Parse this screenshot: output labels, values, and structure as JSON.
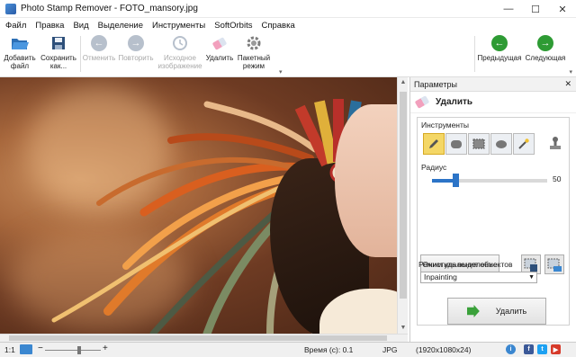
{
  "window": {
    "title": "Photo Stamp Remover - FOTO_mansory.jpg",
    "controls": [
      "—",
      "☐",
      "✕"
    ]
  },
  "menu": [
    "Файл",
    "Правка",
    "Вид",
    "Выделение",
    "Инструменты",
    "SoftOrbits",
    "Справка"
  ],
  "toolbar": {
    "add_file": "Добавить файл",
    "save_as": "Сохранить как...",
    "undo": "Отменить",
    "redo": "Повторить",
    "original": "Исходное изображение",
    "remove": "Удалить",
    "batch": "Пакетный режим",
    "prev": "Предыдущая",
    "next": "Следующая"
  },
  "panel": {
    "header": "Параметры",
    "close": "✕",
    "section": "Удалить",
    "tools_label": "Инструменты",
    "radius_label": "Радиус",
    "radius_value": "50",
    "radius_level": 0.2,
    "clear_selection": "Очистить выделение",
    "mode_label": "Режим удаления объектов",
    "mode_value": "Inpainting",
    "run_button": "Удалить"
  },
  "status": {
    "zoom": "1:1",
    "time": "Время (c): 0.1",
    "format": "JPG",
    "dimensions": "(1920x1080x24)"
  },
  "colors": {
    "accent": "#2c74c7",
    "selected_tool": "#f4d766",
    "nav_green": "#2e9b34"
  }
}
